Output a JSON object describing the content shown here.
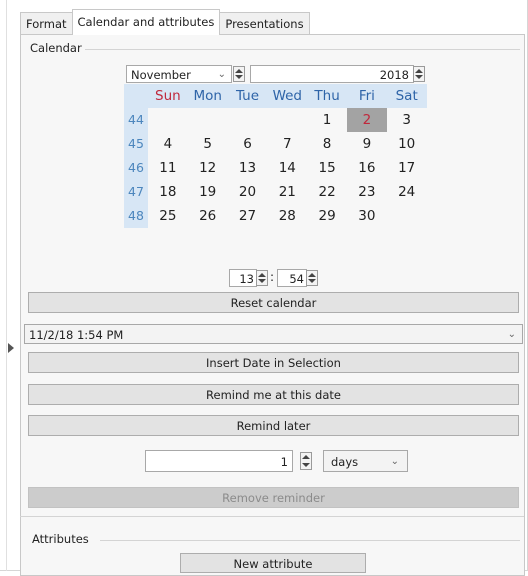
{
  "tabs": [
    "Format",
    "Calendar and attributes",
    "Presentations"
  ],
  "calendar_group": "Calendar",
  "month": "November",
  "year": "2018",
  "weekdays": [
    "Sun",
    "Mon",
    "Tue",
    "Wed",
    "Thu",
    "Fri",
    "Sat"
  ],
  "weeks": [
    {
      "week": "44",
      "days": [
        "",
        "",
        "",
        "",
        "1",
        "2",
        "3"
      ]
    },
    {
      "week": "45",
      "days": [
        "4",
        "5",
        "6",
        "7",
        "8",
        "9",
        "10"
      ]
    },
    {
      "week": "46",
      "days": [
        "11",
        "12",
        "13",
        "14",
        "15",
        "16",
        "17"
      ]
    },
    {
      "week": "47",
      "days": [
        "18",
        "19",
        "20",
        "21",
        "22",
        "23",
        "24"
      ]
    },
    {
      "week": "48",
      "days": [
        "25",
        "26",
        "27",
        "28",
        "29",
        "30",
        ""
      ]
    }
  ],
  "selected_day": "2",
  "time": {
    "hour": "13",
    "minute": "54",
    "separator": ":"
  },
  "buttons": {
    "reset_calendar": "Reset calendar",
    "insert_date": "Insert Date in Selection",
    "remind_at_date": "Remind me at this date",
    "remind_later": "Remind later",
    "remove_reminder": "Remove reminder",
    "new_attribute": "New attribute"
  },
  "selected_datetime": "11/2/18 1:54 PM",
  "remind_qty": "1",
  "remind_unit": "days",
  "attributes_group": "Attributes",
  "colors": {
    "header_bg": "#d7e6f5",
    "weekday_text": "#2e64a8",
    "sunday_text": "#c0283c",
    "week_number_text": "#4c86bd",
    "selected_bg": "#a3a3a3"
  }
}
